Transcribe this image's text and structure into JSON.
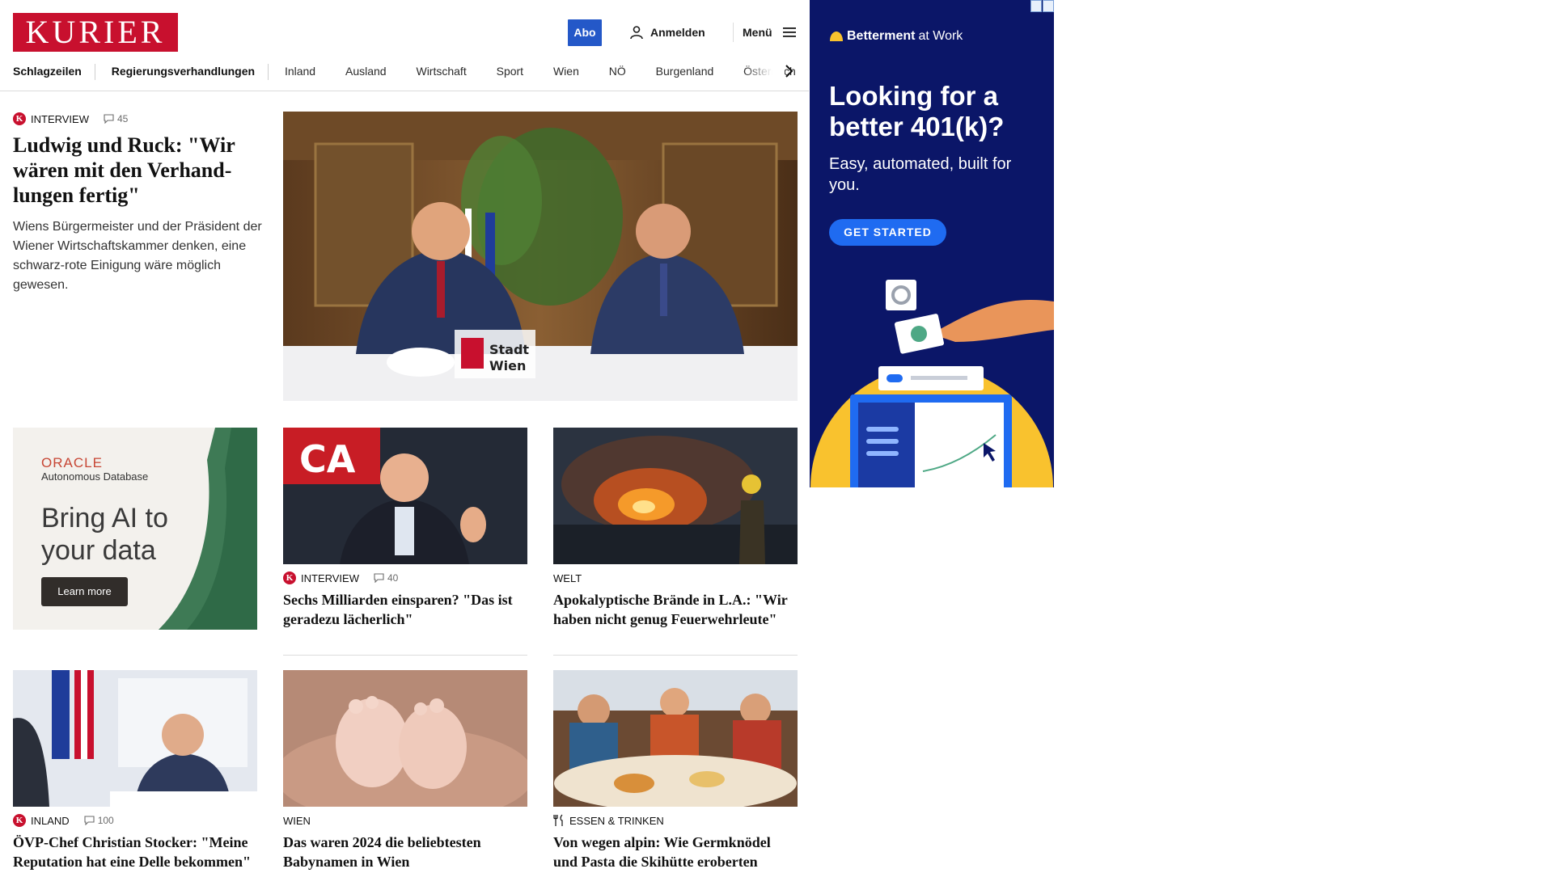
{
  "header": {
    "logo": "KURIER",
    "abo_label": "Abo",
    "login_label": "Anmelden",
    "menu_label": "Menü"
  },
  "nav": {
    "items": [
      "Schlagzeilen",
      "Regierungsverhandlungen",
      "Inland",
      "Ausland",
      "Wirtschaft",
      "Sport",
      "Wien",
      "NÖ",
      "Burgenland",
      "Österreich"
    ]
  },
  "lead": {
    "badge": "K",
    "kicker": "INTERVIEW",
    "comments": "45",
    "headline": "Ludwig und Ruck: \"Wir wären mit den Verhand-lungen fertig\"",
    "teaser": "Wiens Bürgermeister und der Präsident der Wiener Wirtschaftskammer denken, eine schwarz-rote Einigung wäre möglich gewesen.",
    "image_sign": "Stadt Wien"
  },
  "cards": [
    {
      "kicker": "INTERVIEW",
      "badge": "K",
      "comments": "40",
      "headline": "Sechs Milliarden einsparen? \"Das ist geradezu lächerlich\""
    },
    {
      "kicker": "WELT",
      "headline": "Apokalyptische Brände in L.A.: \"Wir haben nicht genug Feuerwehrleute\""
    },
    {
      "kicker": "INLAND",
      "badge": "K",
      "comments": "100",
      "headline": "ÖVP-Chef Christian Stocker: \"Meine Reputation hat eine Delle bekommen\""
    },
    {
      "kicker": "WIEN",
      "headline": "Das waren 2024 die beliebtesten Babynamen in Wien"
    },
    {
      "kicker": "ESSEN & TRINKEN",
      "icon": "fork-knife-icon",
      "headline": "Von wegen alpin: Wie Germknödel und Pasta die Skihütte eroberten"
    }
  ],
  "ads": {
    "oracle": {
      "brand": "ORACLE",
      "sub": "Autonomous Database",
      "headline": "Bring AI to your data",
      "cta": "Learn more"
    },
    "betterment": {
      "brand_bold": "Betterment",
      "brand_rest": "at Work",
      "headline": "Looking for a better 401(k)?",
      "sub": "Easy, automated, built for you.",
      "cta": "GET STARTED"
    }
  },
  "colors": {
    "brand_red": "#c8102e",
    "abo_blue": "#2458c8",
    "ad_navy": "#0b1668",
    "ad_cta": "#1f6bf1",
    "ad_yellow": "#f9c22e"
  }
}
